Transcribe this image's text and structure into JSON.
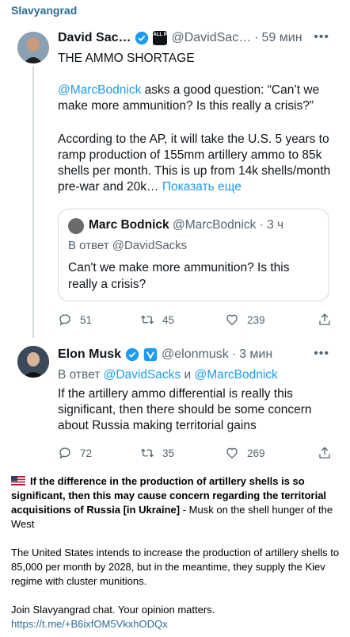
{
  "channel": {
    "name": "Slavyangrad"
  },
  "tweet1": {
    "name": "David Sac…",
    "handle": "@DavidSac…",
    "time": "59 мин",
    "headline": "THE AMMO SHORTAGE",
    "mention": "@MarcBodnick",
    "body1": " asks a good question: “Can’t we make more ammunition? Is this really a crisis?”",
    "body2": "According to the AP, it will take the U.S. 5 years to ramp production of 155mm artillery ammo to 85k shells per month. This is up from 14k shells/month pre-war and 20k… ",
    "show_more": "Показать еще",
    "quote": {
      "name": "Marc Bodnick",
      "handle": "@MarcBodnick",
      "time": "3 ч",
      "reply_to": "В ответ @DavidSacks",
      "text": "Can't we make more ammunition? Is this really a crisis?"
    },
    "replies": "51",
    "retweets": "45",
    "likes": "239",
    "org_badge_text": "ALL IN"
  },
  "tweet2": {
    "name": "Elon Musk",
    "handle": "@elonmusk",
    "time": "3 мин",
    "reply_prefix": "В ответ ",
    "reply_user1": "@DavidSacks",
    "reply_and": " и ",
    "reply_user2": "@MarcBodnick",
    "text": "If the artillery ammo differential is really this significant, then there should be some concern about Russia making territorial gains",
    "replies": "72",
    "retweets": "35",
    "likes": "269"
  },
  "caption": {
    "bold_text": "If the difference in the production of artillery shells is so significant, then this may cause concern regarding the territorial acquisitions of Russia [in Ukraine]",
    "after_bold": " - Musk on the shell hunger of the West",
    "para2": "The United States intends to increase the production of artillery shells to 85,000 per month by 2028, but in the meantime, they supply the Kiev regime with cluster munitions.",
    "para3": "Join Slavyangrad chat. Your opinion matters.",
    "link": "https://t.me/+B6ixfOM5VkxhODQx"
  },
  "colors": {
    "accent": "#1d9bf0",
    "channel": "#2c6e9b",
    "muted": "#536471",
    "border": "#cfd9de"
  }
}
